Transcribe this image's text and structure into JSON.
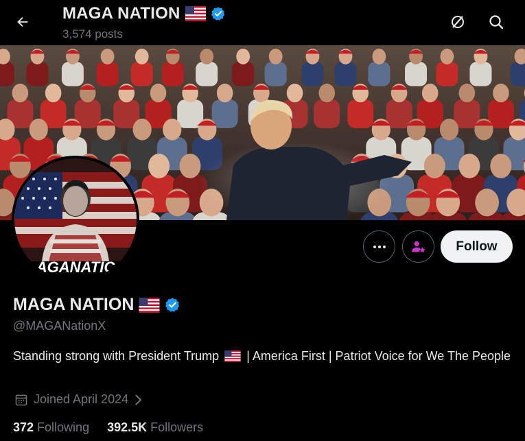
{
  "header": {
    "title": "MAGA NATION",
    "posts_count": "3,574 posts",
    "back_icon": "arrow-left-icon",
    "right_icons": [
      "grok-icon",
      "search-icon"
    ]
  },
  "banner": {
    "description_icon": "rally-crowd-photo"
  },
  "avatar": {
    "text": "AGANATIC"
  },
  "actions": {
    "more_icon": "more-dots-icon",
    "subscribe_icon": "person-star-icon",
    "follow_label": "Follow"
  },
  "profile": {
    "name": "MAGA NATION",
    "handle": "@MAGANationX",
    "bio_part1": "Standing strong with President Trump",
    "bio_part2": "| America First | Patriot Voice for We The People",
    "joined": "Joined April 2024",
    "following_count": "372",
    "following_label": "Following",
    "followers_count": "392.5K",
    "followers_label": "Followers"
  },
  "colors": {
    "background": "#000000",
    "verified": "#1d9bf0",
    "secondary_text": "#71767b",
    "accent_purple": "#c936c9"
  }
}
